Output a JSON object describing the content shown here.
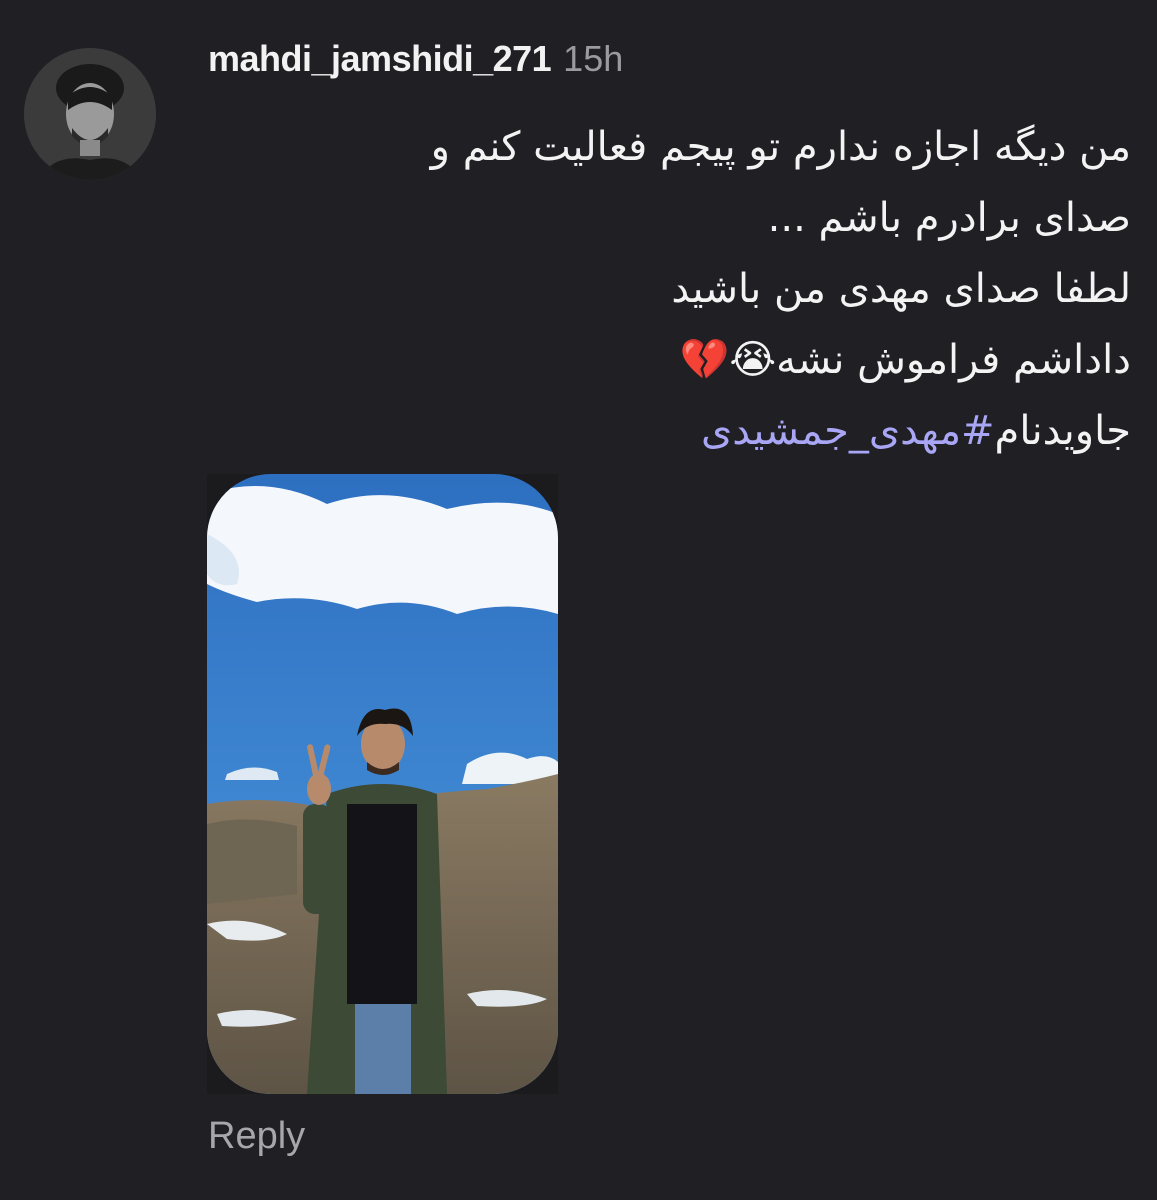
{
  "comment": {
    "username": "mahdi_jamshidi_271",
    "timestamp": "15h",
    "lines": [
      "من دیگه اجازه ندارم تو پیجم فعالیت کنم و",
      "صدای برادرم باشم ...",
      "لطفا صدای مهدی من باشید",
      "داداشم فراموش نشه"
    ],
    "line4_emojis": "😭💔",
    "hashtag_prefix": "جاویدنام",
    "hashtag": "#مهدی_جمشیدی",
    "reply_label": "Reply"
  },
  "icons": {
    "avatar": "profile-photo",
    "attachment": "photo-attachment"
  },
  "colors": {
    "background": "#1f1f24",
    "username": "#f2f2f2",
    "timestamp": "#9a9a9f",
    "body_text": "#f3f3f3",
    "hashtag": "#a9a6f5",
    "reply": "#a6a6ab"
  }
}
